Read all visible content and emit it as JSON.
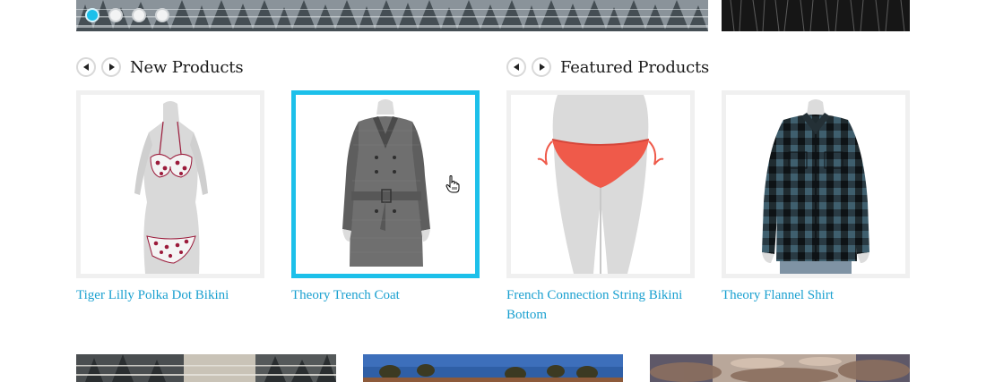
{
  "carousel": {
    "slide_count": 4,
    "active_slide": 1
  },
  "sections": {
    "new_products": {
      "title": "New Products",
      "prev_icon": "arrow-left-icon",
      "next_icon": "arrow-right-icon"
    },
    "featured_products": {
      "title": "Featured Products",
      "prev_icon": "arrow-left-icon",
      "next_icon": "arrow-right-icon"
    }
  },
  "products": [
    {
      "name": "Tiger Lilly Polka Dot Bikini",
      "selected": false
    },
    {
      "name": "Theory Trench Coat",
      "selected": true
    },
    {
      "name": "French Connection String Bikini Bottom",
      "selected": false
    },
    {
      "name": "Theory Flannel Shirt",
      "selected": false
    }
  ],
  "colors": {
    "accent": "#1cc0ea",
    "link": "#1aa0d0",
    "frame_border": "#f0f0f0",
    "title_text": "#1a1a1a"
  },
  "icons": [
    "arrow-left-icon",
    "arrow-right-icon",
    "hand-pointer-icon"
  ]
}
